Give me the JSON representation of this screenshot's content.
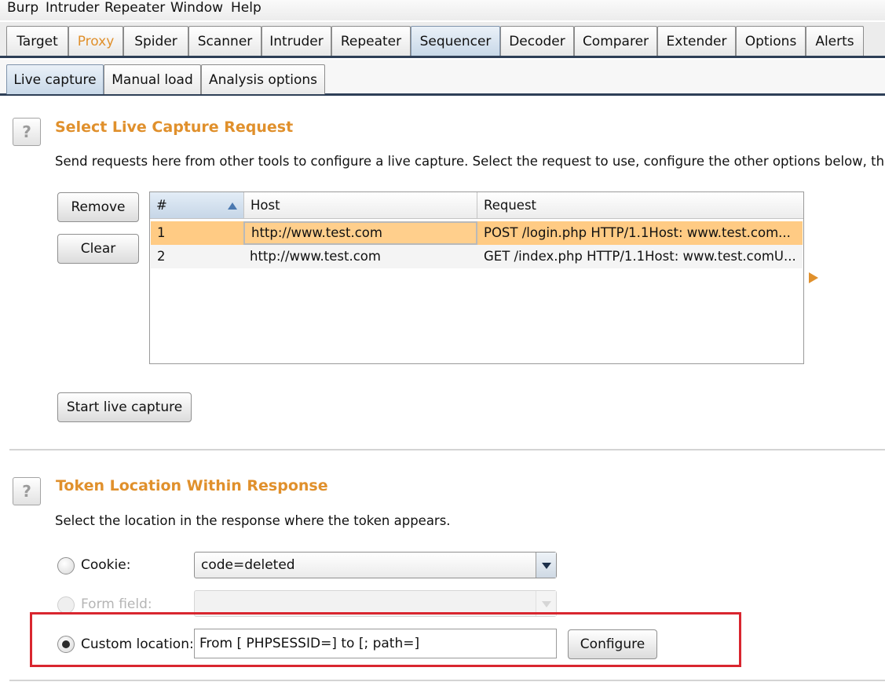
{
  "menu": [
    "Burp",
    "Intruder",
    "Repeater",
    "Window",
    "Help"
  ],
  "main_tabs": [
    "Target",
    "Proxy",
    "Spider",
    "Scanner",
    "Intruder",
    "Repeater",
    "Sequencer",
    "Decoder",
    "Comparer",
    "Extender",
    "Options",
    "Alerts"
  ],
  "main_tab_selected": "Sequencer",
  "sub_tabs": [
    "Live capture",
    "Manual load",
    "Analysis options"
  ],
  "sub_tab_selected": "Live capture",
  "help_glyph": "?",
  "capture": {
    "title": "Select Live Capture Request",
    "description": "Send requests here from other tools to configure a live capture. Select the request to use, configure the other options below, then clic",
    "remove_label": "Remove",
    "clear_label": "Clear",
    "start_label": "Start live capture",
    "columns": [
      "#",
      "Host",
      "Request"
    ],
    "rows": [
      {
        "num": "1",
        "host": "http://www.test.com",
        "request": "POST /login.php HTTP/1.1Host: www.test.com..."
      },
      {
        "num": "2",
        "host": "http://www.test.com",
        "request": "GET /index.php HTTP/1.1Host: www.test.comU..."
      }
    ],
    "selected_row": "1"
  },
  "token": {
    "title": "Token Location Within Response",
    "description": "Select the location in the response where the token appears.",
    "cookie_label": "Cookie:",
    "cookie_value": "code=deleted",
    "form_field_label": "Form field:",
    "custom_label": "Custom location:",
    "custom_value": "From [ PHPSESSID=] to [; path=]",
    "configure_label": "Configure",
    "selected_option": "Custom location"
  },
  "colors": {
    "accent_orange": "#e0902c",
    "selected_row": "#ffcb84",
    "highlight_red": "#d9262f",
    "tab_underline": "#2e3f57"
  }
}
